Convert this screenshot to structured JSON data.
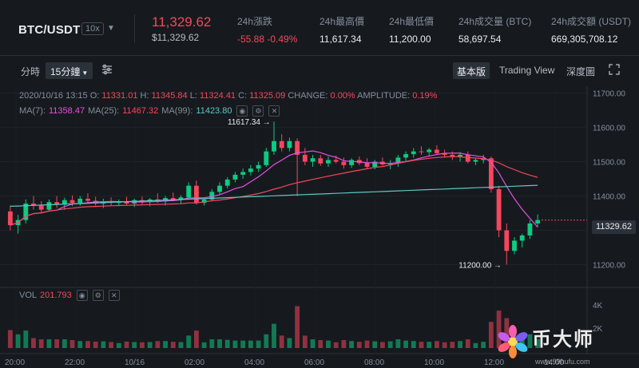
{
  "ticker": {
    "pair": "BTC/USDT",
    "leverage": "10x",
    "last_price": "11,329.62",
    "last_price_usd": "$11,329.62",
    "stats": [
      {
        "key": "change",
        "label": "24h漲跌",
        "value": "-55.88 -0.49%"
      },
      {
        "key": "high",
        "label": "24h最高價",
        "value": "11,617.34"
      },
      {
        "key": "low",
        "label": "24h最低價",
        "value": "11,200.00"
      },
      {
        "key": "vol_btc",
        "label": "24h成交量 (BTC)",
        "value": "58,697.54"
      },
      {
        "key": "vol_usdt",
        "label": "24h成交額 (USDT)",
        "value": "669,305,708.12"
      }
    ],
    "negative_color": "#f6465d",
    "positive_color": "#0ecb81"
  },
  "toolbar": {
    "time_label": "分時",
    "interval": "15分鐘",
    "views": [
      "基本版",
      "Trading View",
      "深度圖"
    ],
    "active_view": "基本版"
  },
  "legend": {
    "datetime": "2020/10/16 13:15",
    "o_label": "O:",
    "o_value": "11331.01",
    "h_label": "H:",
    "h_value": "11345.84",
    "l_label": "L:",
    "l_value": "11324.41",
    "c_label": "C:",
    "c_value": "11325.09",
    "change_label": "CHANGE:",
    "change_value": "0.00%",
    "amp_label": "AMPLITUDE:",
    "amp_value": "0.19%",
    "ma7_label": "MA(7):",
    "ma7_value": "11358.47",
    "ma25_label": "MA(25):",
    "ma25_value": "11467.32",
    "ma99_label": "MA(99):",
    "ma99_value": "11423.80",
    "vol_label": "VOL",
    "vol_value": "201.793"
  },
  "chart_data": {
    "type": "candlestick",
    "price_axis": {
      "min": 11150,
      "max": 11720,
      "ticks": [
        "11700.00",
        "11600.00",
        "11500.00",
        "11400.00",
        "11300.00",
        "11200.00"
      ]
    },
    "current_price_label": "11329.62",
    "high_marker": "11617.34",
    "low_marker": "11200.00",
    "volume_axis": {
      "ticks": [
        "4K",
        "2K"
      ]
    },
    "time_axis": [
      "20:00",
      "22:00",
      "10/16",
      "02:00",
      "04:00",
      "06:00",
      "08:00",
      "10:00",
      "12:00",
      "14:00"
    ],
    "ma_colors": {
      "ma7": "#e84fe4",
      "ma25": "#f6465d",
      "ma99": "#5ec6c6"
    },
    "candles": [
      [
        11355,
        11372,
        11300,
        11315
      ],
      [
        11315,
        11345,
        11290,
        11330
      ],
      [
        11330,
        11390,
        11320,
        11378
      ],
      [
        11378,
        11400,
        11360,
        11372
      ],
      [
        11372,
        11385,
        11350,
        11360
      ],
      [
        11360,
        11390,
        11355,
        11382
      ],
      [
        11382,
        11400,
        11365,
        11375
      ],
      [
        11375,
        11395,
        11360,
        11388
      ],
      [
        11388,
        11402,
        11370,
        11380
      ],
      [
        11380,
        11400,
        11372,
        11392
      ],
      [
        11392,
        11408,
        11380,
        11386
      ],
      [
        11386,
        11398,
        11372,
        11378
      ],
      [
        11378,
        11392,
        11365,
        11384
      ],
      [
        11384,
        11396,
        11372,
        11380
      ],
      [
        11380,
        11390,
        11370,
        11385
      ],
      [
        11385,
        11398,
        11372,
        11378
      ],
      [
        11378,
        11392,
        11368,
        11388
      ],
      [
        11388,
        11398,
        11375,
        11382
      ],
      [
        11382,
        11394,
        11370,
        11390
      ],
      [
        11390,
        11408,
        11380,
        11384
      ],
      [
        11384,
        11400,
        11372,
        11394
      ],
      [
        11394,
        11410,
        11385,
        11388
      ],
      [
        11388,
        11402,
        11378,
        11396
      ],
      [
        11396,
        11440,
        11390,
        11430
      ],
      [
        11430,
        11445,
        11375,
        11380
      ],
      [
        11380,
        11395,
        11372,
        11390
      ],
      [
        11390,
        11420,
        11385,
        11412
      ],
      [
        11412,
        11440,
        11405,
        11430
      ],
      [
        11430,
        11455,
        11422,
        11448
      ],
      [
        11448,
        11470,
        11440,
        11462
      ],
      [
        11462,
        11480,
        11450,
        11470
      ],
      [
        11470,
        11490,
        11460,
        11480
      ],
      [
        11480,
        11500,
        11470,
        11490
      ],
      [
        11490,
        11540,
        11485,
        11530
      ],
      [
        11530,
        11617,
        11520,
        11560
      ],
      [
        11560,
        11580,
        11530,
        11540
      ],
      [
        11540,
        11570,
        11530,
        11560
      ],
      [
        11560,
        11568,
        11400,
        11520
      ],
      [
        11520,
        11540,
        11490,
        11500
      ],
      [
        11500,
        11520,
        11485,
        11510
      ],
      [
        11510,
        11520,
        11488,
        11495
      ],
      [
        11495,
        11515,
        11485,
        11505
      ],
      [
        11505,
        11518,
        11495,
        11500
      ],
      [
        11500,
        11512,
        11480,
        11490
      ],
      [
        11490,
        11510,
        11482,
        11505
      ],
      [
        11505,
        11515,
        11490,
        11496
      ],
      [
        11496,
        11510,
        11480,
        11485
      ],
      [
        11485,
        11505,
        11478,
        11500
      ],
      [
        11500,
        11512,
        11488,
        11492
      ],
      [
        11492,
        11505,
        11478,
        11495
      ],
      [
        11495,
        11520,
        11485,
        11512
      ],
      [
        11512,
        11530,
        11500,
        11522
      ],
      [
        11522,
        11540,
        11512,
        11530
      ],
      [
        11530,
        11545,
        11520,
        11528
      ],
      [
        11528,
        11540,
        11515,
        11535
      ],
      [
        11535,
        11548,
        11520,
        11525
      ],
      [
        11525,
        11535,
        11512,
        11520
      ],
      [
        11520,
        11530,
        11505,
        11515
      ],
      [
        11515,
        11528,
        11500,
        11520
      ],
      [
        11520,
        11530,
        11495,
        11500
      ],
      [
        11500,
        11510,
        11490,
        11505
      ],
      [
        11505,
        11520,
        11495,
        11510
      ],
      [
        11510,
        11515,
        11410,
        11420
      ],
      [
        11420,
        11430,
        11280,
        11300
      ],
      [
        11300,
        11320,
        11200,
        11240
      ],
      [
        11240,
        11280,
        11230,
        11270
      ],
      [
        11270,
        11290,
        11250,
        11285
      ],
      [
        11285,
        11330,
        11275,
        11320
      ],
      [
        11320,
        11346,
        11310,
        11330
      ]
    ]
  }
}
